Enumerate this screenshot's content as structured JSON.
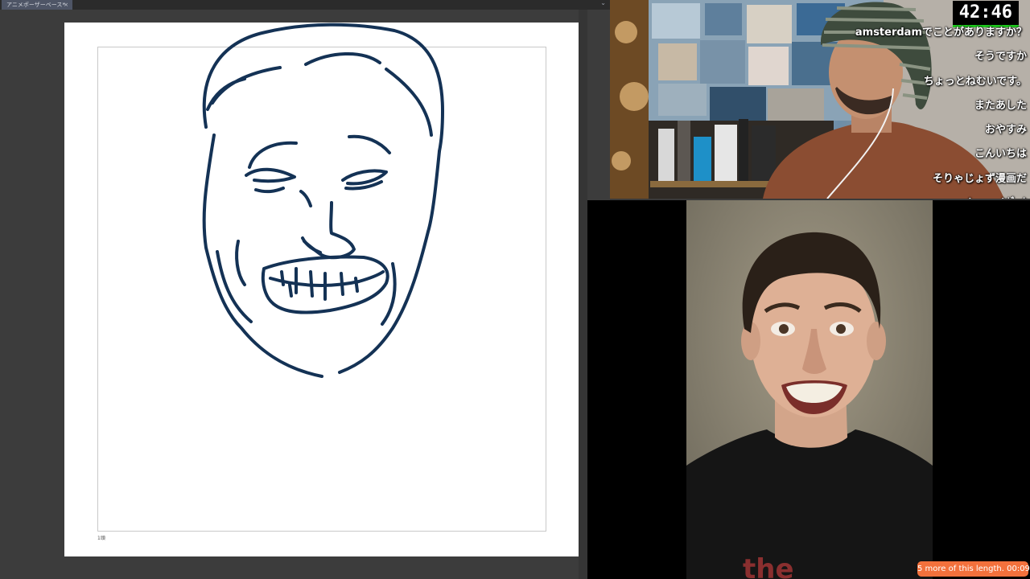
{
  "app": {
    "tab_title": "アニメポーザーベース*",
    "tab_close": "×",
    "tab_menu": "⌄",
    "page_label": "1頭"
  },
  "stream": {
    "timer": "42:46",
    "timer_accent": "#1ec81e",
    "chat_messages": [
      "amsterdamでことがありますか？",
      "そうですか",
      "ちょっとねむいです。",
      "またあした",
      "おやすみ",
      "こんいちは",
      "そりゃじょず漫画だ",
      "( ･ - ･ )ﾎﾞｰｸ"
    ],
    "close_glyph": "×"
  },
  "reference": {
    "shirt_text": "the",
    "session_badge": "5 more of this length. 00:09",
    "badge_color": "#f3713c"
  },
  "colors": {
    "ink": "#143255",
    "paper": "#ffffff",
    "workspace": "#3c3c3c"
  }
}
